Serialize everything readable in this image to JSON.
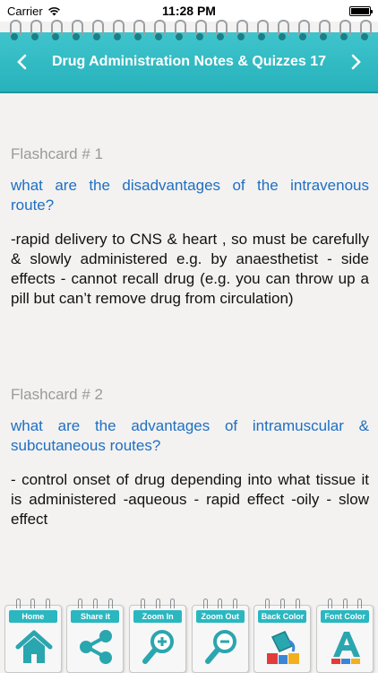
{
  "status_bar": {
    "carrier": "Carrier",
    "time": "11:28 PM"
  },
  "header": {
    "title": "Drug Administration Notes & Quizzes 17",
    "prev_icon": "chevron-left-icon",
    "next_icon": "chevron-right-icon"
  },
  "cards": [
    {
      "label": "Flashcard # 1",
      "question": "what are the disadvantages of the intravenous route?",
      "answer": "-rapid delivery to CNS & heart , so must be carefully & slowly administered e.g. by anaesthetist - side effects - cannot recall drug (e.g. you can throw up a pill but can’t remove drug from circulation)"
    },
    {
      "label": "Flashcard # 2",
      "question": "what are the advantages of intramuscular & subcutaneous routes?",
      "answer": "- control onset of drug depending into what tissue it is administered -aqueous - rapid effect -oily - slow effect"
    }
  ],
  "toolbar": {
    "home": "Home",
    "share": "Share it",
    "zoom_in": "Zoom In",
    "zoom_out": "Zoom Out",
    "back_color": "Back Color",
    "font_color": "Font Color"
  },
  "colors": {
    "accent": "#2bb7c0",
    "question_text": "#1f6fc4",
    "label_text": "#9a9a9a"
  }
}
